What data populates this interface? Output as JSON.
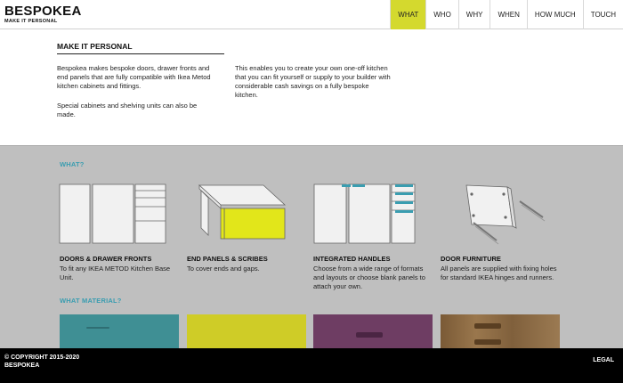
{
  "brand": {
    "title": "BESPOKEA",
    "subtitle": "MAKE IT PERSONAL"
  },
  "nav": {
    "items": [
      {
        "label": "WHAT",
        "active": true
      },
      {
        "label": "WHO"
      },
      {
        "label": "WHY"
      },
      {
        "label": "WHEN"
      },
      {
        "label": "HOW MUCH"
      },
      {
        "label": "TOUCH"
      }
    ]
  },
  "intro": {
    "title": "MAKE IT PERSONAL",
    "paragraph1": "Bespokea makes bespoke doors, drawer fronts and end panels that are fully compatible with Ikea Metod kitchen cabinets and fittings.",
    "paragraph2": "Special cabinets and shelving units can also be made.",
    "paragraph3": "This enables you to create your own one-off kitchen that you can fit yourself or supply to your builder with considerable cash savings on a fully bespoke kitchen."
  },
  "what": {
    "label": "WHAT?",
    "features": [
      {
        "title": "DOORS & DRAWER FRONTS",
        "desc": "To fit any IKEA METOD Kitchen Base Unit.",
        "icon": "doors-drawers-icon"
      },
      {
        "title": "END PANELS & SCRIBES",
        "desc": "To cover ends and gaps.",
        "icon": "end-panels-icon"
      },
      {
        "title": "INTEGRATED HANDLES",
        "desc": "Choose from a wide range of formats and layouts or choose blank panels to attach your own.",
        "icon": "integrated-handles-icon"
      },
      {
        "title": "DOOR FURNITURE",
        "desc": "All panels are supplied with fixing holes for standard IKEA hinges and runners.",
        "icon": "door-furniture-icon"
      }
    ]
  },
  "material": {
    "label": "WHAT MATERIAL?",
    "swatches": [
      {
        "name": "teal-swatch",
        "color": "#3f8f94"
      },
      {
        "name": "yellow-swatch",
        "color": "#cfcc27"
      },
      {
        "name": "purple-swatch",
        "color": "#6e3d63"
      },
      {
        "name": "wood-swatch",
        "color": "#8a6a45"
      }
    ]
  },
  "colors": {
    "accent": "#d4d92e",
    "teal": "#3a9db0",
    "gray": "#bfbfbf"
  },
  "footer": {
    "copyright": "© COPYRIGHT 2015-2020",
    "company": "BESPOKEA",
    "legal": "LEGAL"
  }
}
